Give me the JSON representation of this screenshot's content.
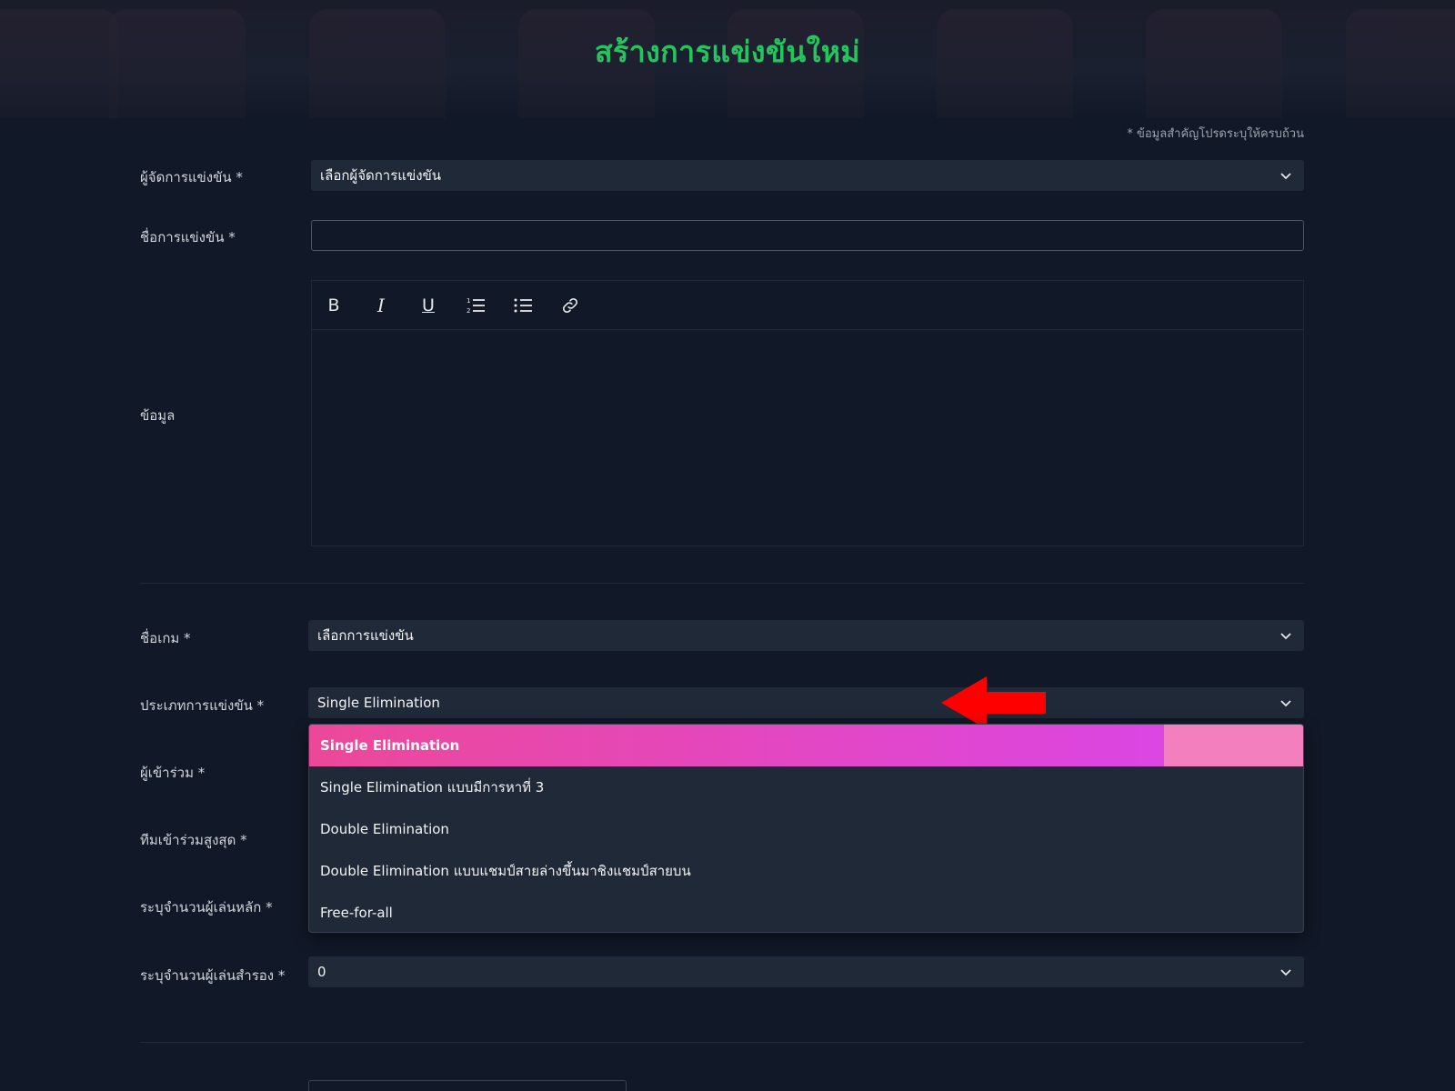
{
  "colors": {
    "title_green": "#22c55e",
    "selected_pink": "#ec4899",
    "selected_purple": "#d946ef",
    "arrow_red": "#ff0000",
    "field_bg": "#1f2937",
    "page_bg": "#111827"
  },
  "header": {
    "title": "สร้างการแข่งขันใหม่"
  },
  "required_note": "* ข้อมูลสำคัญโปรดระบุให้ครบถ้วน",
  "form": {
    "organizer": {
      "label": "ผู้จัดการแข่งขัน *",
      "value": "เลือกผู้จัดการแข่งขัน",
      "icon": "chevron-down-icon"
    },
    "tournament_name": {
      "label": "ชื่อการแข่งขัน *",
      "value": "",
      "placeholder": ""
    },
    "description": {
      "label": "ข้อมูล",
      "toolbar": [
        {
          "name": "bold-icon",
          "glyph": "B"
        },
        {
          "name": "italic-icon",
          "glyph": "I"
        },
        {
          "name": "underline-icon",
          "glyph": "U"
        },
        {
          "name": "ordered-list-icon",
          "glyph": ""
        },
        {
          "name": "bullet-list-icon",
          "glyph": ""
        },
        {
          "name": "link-icon",
          "glyph": ""
        }
      ]
    },
    "game": {
      "label": "ชื่อเกม *",
      "value": "เลือกการแข่งขัน",
      "icon": "chevron-down-icon"
    },
    "tournament_type": {
      "label": "ประเภทการแข่งขัน *",
      "value": "Single Elimination",
      "icon": "chevron-down-icon",
      "options": [
        "Single Elimination",
        "Single Elimination แบบมีการหาที่ 3",
        "Double Elimination",
        "Double Elimination แบบแชมป์สายล่างขึ้นมาชิงแชมป์สายบน",
        "Free-for-all"
      ],
      "selected_index": 0
    },
    "participants": {
      "label": "ผู้เข้าร่วม *"
    },
    "max_teams": {
      "label": "ทีมเข้าร่วมสูงสุด *"
    },
    "main_players": {
      "label": "ระบุจำนวนผู้เล่นหลัก *"
    },
    "sub_players": {
      "label": "ระบุจำนวนผู้เล่นสำรอง *",
      "value": "0",
      "icon": "chevron-down-icon"
    }
  }
}
